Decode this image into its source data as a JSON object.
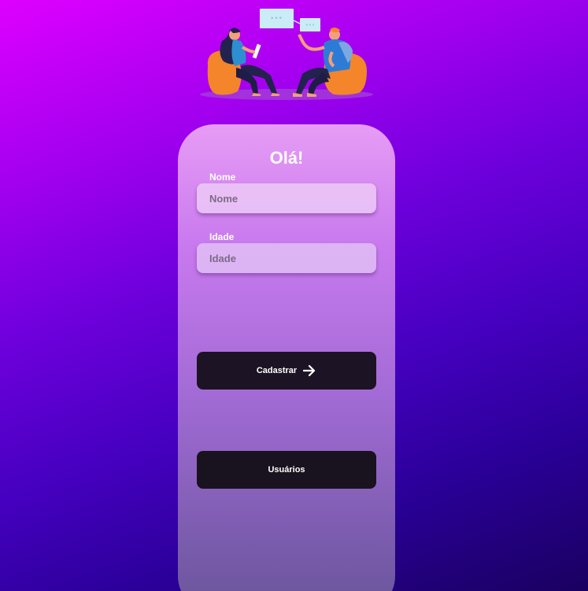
{
  "colors": {
    "button_bg": "#1c1424",
    "accent_orange": "#f4852a",
    "bubble": "#c9ecf6"
  },
  "illustration": {
    "icon": "conversation-illustration",
    "bubble_text_left": "•••",
    "bubble_text_right": "•••"
  },
  "card": {
    "title": "Olá!"
  },
  "form": {
    "nome": {
      "label": "Nome",
      "placeholder": "Nome",
      "value": ""
    },
    "idade": {
      "label": "Idade",
      "placeholder": "Idade",
      "value": ""
    }
  },
  "buttons": {
    "cadastrar_label": "Cadastrar",
    "cadastrar_icon": "arrow-right-icon",
    "usuarios_label": "Usuários"
  }
}
